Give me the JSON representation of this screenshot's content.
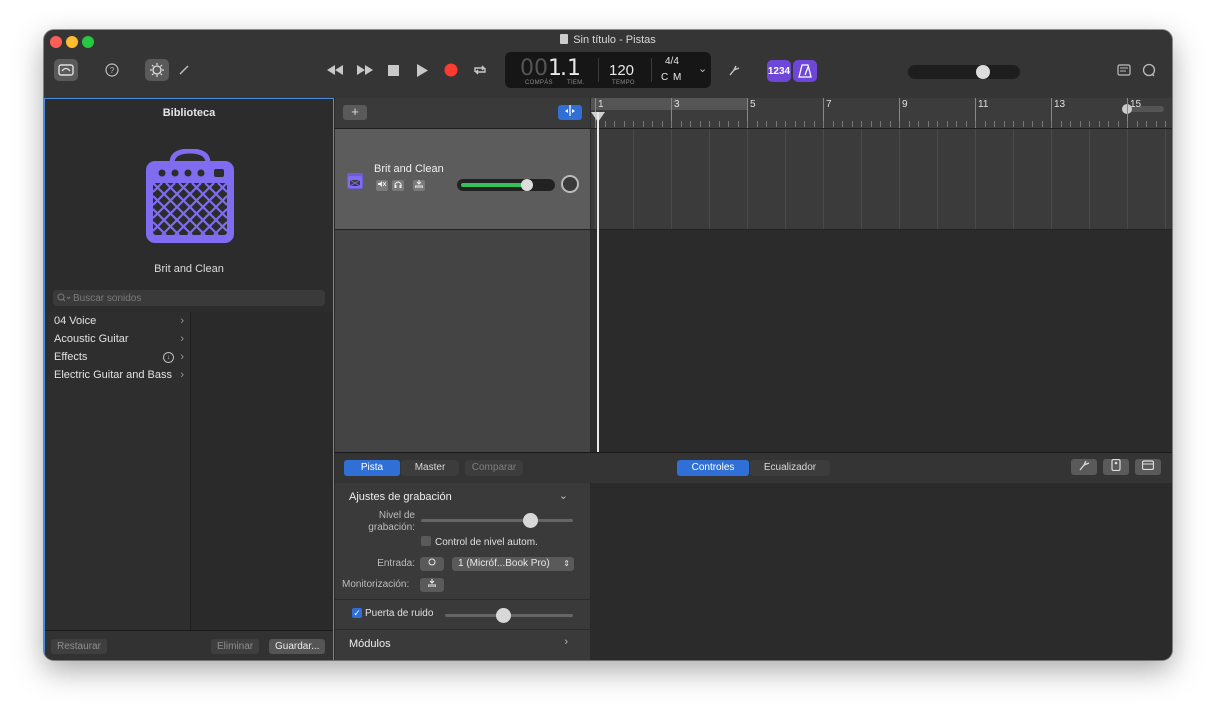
{
  "window": {
    "title": "Sin título - Pistas"
  },
  "lcd": {
    "bar_dim": "00",
    "bar": "1",
    "beat": ".1",
    "bar_label": "COMPÁS",
    "beat_label": "TIEM.",
    "tempo": "120",
    "tempo_label": "TEMPO",
    "signature": "4/4",
    "key": "C M"
  },
  "toolbar": {
    "count_in_label": "1234",
    "colors": {
      "accent": "#6e46d8",
      "record": "#ff3b30",
      "smart_controls": "#2f6fd6"
    }
  },
  "library": {
    "title": "Biblioteca",
    "patch_name": "Brit and Clean",
    "search_placeholder": "Buscar sonidos",
    "categories": [
      {
        "label": "04 Voice",
        "download": false
      },
      {
        "label": "Acoustic Guitar",
        "download": false
      },
      {
        "label": "Effects",
        "download": true
      },
      {
        "label": "Electric Guitar and Bass",
        "download": false
      }
    ],
    "restore_label": "Restaurar",
    "delete_label": "Eliminar",
    "save_label": "Guardar..."
  },
  "tracks": {
    "add_label": "+",
    "items": [
      {
        "name": "Brit and Clean",
        "volume": 0.68
      }
    ]
  },
  "ruler": {
    "bars": [
      "1",
      "3",
      "5",
      "7",
      "9",
      "11",
      "13",
      "15"
    ]
  },
  "editor": {
    "tab_track": "Pista",
    "tab_master": "Master",
    "tab_compare": "Comparar",
    "tab_controls": "Controles",
    "tab_eq": "Ecualizador"
  },
  "inspector": {
    "section_title": "Ajustes de grabación",
    "level_label_1": "Nivel de",
    "level_label_2": "grabación:",
    "recording_level": 0.72,
    "auto_level_label": "Control de nivel autom.",
    "auto_level_checked": false,
    "input_label": "Entrada:",
    "input_value": "1 (Micróf...Book Pro)",
    "monitor_label": "Monitorización:",
    "noise_gate_label": "Puerta de ruido",
    "noise_gate_checked": true,
    "noise_gate_level": 0.45,
    "plugins_label": "Módulos"
  }
}
